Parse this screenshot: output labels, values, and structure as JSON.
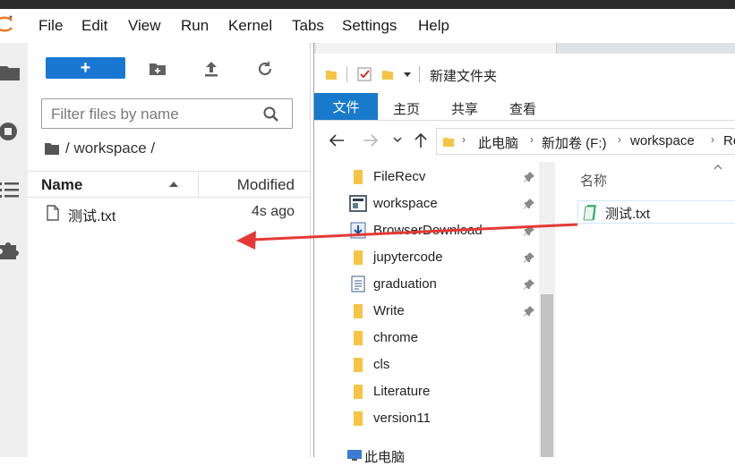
{
  "menubar": {
    "items": [
      "File",
      "Edit",
      "View",
      "Run",
      "Kernel",
      "Tabs",
      "Settings",
      "Help"
    ]
  },
  "filebrowser": {
    "new_button": "+",
    "filter_placeholder": "Filter files by name",
    "breadcrumb": "/ workspace /",
    "columns": {
      "name": "Name",
      "modified": "Modified"
    },
    "files": [
      {
        "name": "测试.txt",
        "modified": "4s ago"
      }
    ]
  },
  "explorer": {
    "title": "新建文件夹",
    "ribbon": {
      "file": "文件",
      "tabs": [
        "主页",
        "共享",
        "查看"
      ]
    },
    "address": [
      "此电脑",
      "新加卷 (F:)",
      "workspace",
      "Re"
    ],
    "nav_items": [
      {
        "label": "FileRecv",
        "icon": "folder-icon",
        "pinned": true
      },
      {
        "label": "workspace",
        "icon": "app-window-icon",
        "pinned": true
      },
      {
        "label": "BrowserDownload",
        "icon": "download-folder-icon",
        "pinned": true
      },
      {
        "label": "jupytercode",
        "icon": "folder-icon",
        "pinned": true
      },
      {
        "label": "graduation",
        "icon": "document-icon",
        "pinned": true
      },
      {
        "label": "Write",
        "icon": "folder-icon",
        "pinned": true
      },
      {
        "label": "chrome",
        "icon": "folder-icon",
        "pinned": false
      },
      {
        "label": "cls",
        "icon": "folder-icon",
        "pinned": false
      },
      {
        "label": "Literature",
        "icon": "folder-icon",
        "pinned": false
      },
      {
        "label": "version11",
        "icon": "folder-icon",
        "pinned": false
      },
      {
        "label": "此电脑",
        "icon": "computer-icon",
        "pinned": false
      }
    ],
    "content_header": "名称",
    "files": [
      {
        "name": "测试.txt"
      }
    ]
  },
  "colors": {
    "jupyter_blue": "#1976d2",
    "ribbon_blue": "#1979ca",
    "arrow_red": "#e53935",
    "folder": "#f6c445"
  }
}
